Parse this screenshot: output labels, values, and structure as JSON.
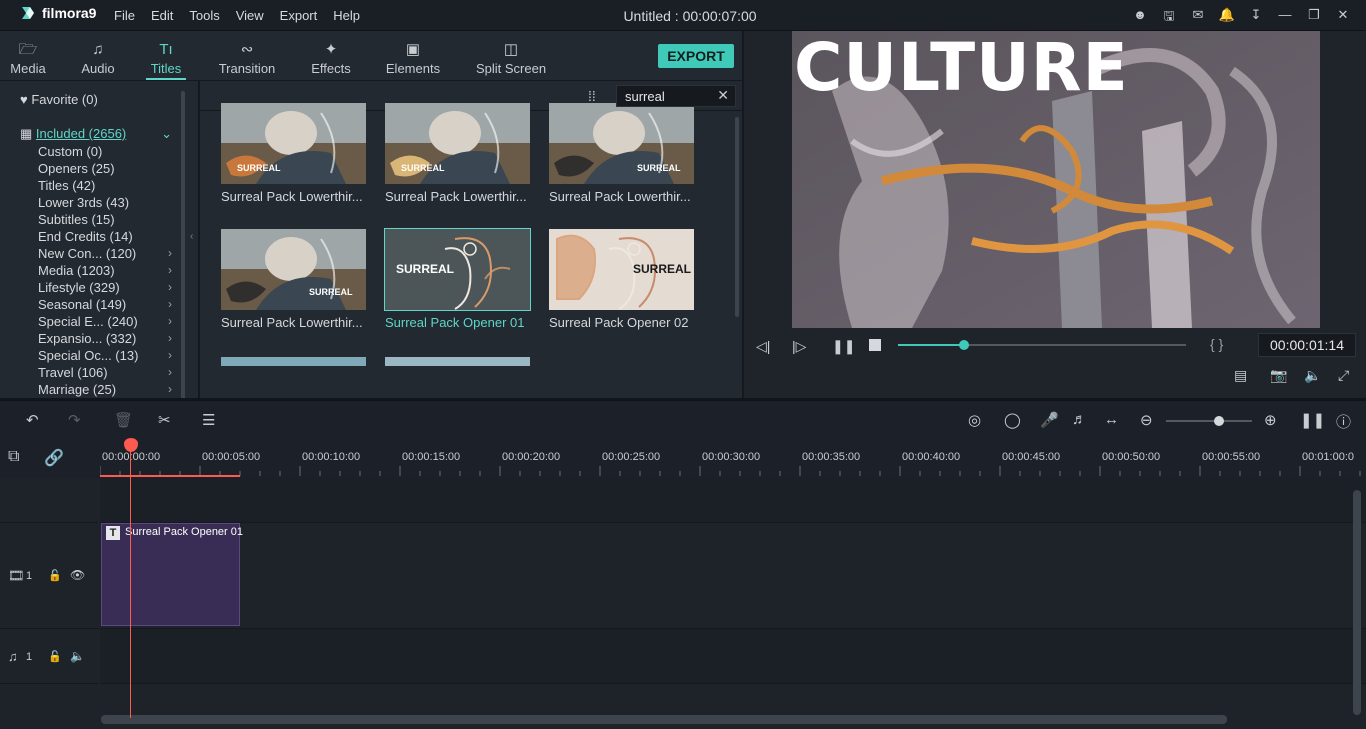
{
  "app": {
    "name": "filmora9",
    "title": "Untitled : 00:00:07:00",
    "menu": [
      "File",
      "Edit",
      "Tools",
      "View",
      "Export",
      "Help"
    ]
  },
  "tabs": [
    {
      "label": "Media",
      "icon": "media-icon"
    },
    {
      "label": "Audio",
      "icon": "music-note-icon"
    },
    {
      "label": "Titles",
      "icon": "titles-icon",
      "active": true
    },
    {
      "label": "Transition",
      "icon": "transition-icon"
    },
    {
      "label": "Effects",
      "icon": "effects-icon"
    },
    {
      "label": "Elements",
      "icon": "elements-icon"
    },
    {
      "label": "Split Screen",
      "icon": "split-screen-icon"
    }
  ],
  "export_label": "EXPORT",
  "favorite": "Favorite (0)",
  "included": "Included (2656)",
  "categories": [
    {
      "label": "Custom (0)",
      "has_children": false
    },
    {
      "label": "Openers (25)",
      "has_children": false
    },
    {
      "label": "Titles (42)",
      "has_children": false
    },
    {
      "label": "Lower 3rds (43)",
      "has_children": false
    },
    {
      "label": "Subtitles (15)",
      "has_children": false
    },
    {
      "label": "End Credits (14)",
      "has_children": false
    },
    {
      "label": "New Con... (120)",
      "has_children": true
    },
    {
      "label": "Media (1203)",
      "has_children": true
    },
    {
      "label": "Lifestyle (329)",
      "has_children": true
    },
    {
      "label": "Seasonal (149)",
      "has_children": true
    },
    {
      "label": "Special E... (240)",
      "has_children": true
    },
    {
      "label": "Expansio... (332)",
      "has_children": true
    },
    {
      "label": "Special Oc... (13)",
      "has_children": true
    },
    {
      "label": "Travel (106)",
      "has_children": true
    },
    {
      "label": "Marriage (25)",
      "has_children": true
    }
  ],
  "search": {
    "value": "surreal"
  },
  "thumbnails": [
    {
      "label": "Surreal Pack Lowerthir...",
      "overlay": "SURREAL",
      "selected": false
    },
    {
      "label": "Surreal Pack Lowerthir...",
      "overlay": "SURREAL",
      "selected": false
    },
    {
      "label": "Surreal Pack Lowerthir...",
      "overlay": "SURREAL",
      "selected": false
    },
    {
      "label": "Surreal Pack Lowerthir...",
      "overlay": "SURREAL",
      "selected": false
    },
    {
      "label": "Surreal Pack Opener 01",
      "overlay": "SURREAL",
      "selected": true
    },
    {
      "label": "Surreal Pack Opener 02",
      "overlay": "SURREAL",
      "selected": false
    }
  ],
  "preview": {
    "overlay_text": "CULTURE",
    "timecode": "00:00:01:14",
    "progress": 0.23,
    "brackets": "{   }"
  },
  "ruler": [
    "00:00:00:00",
    "00:00:05:00",
    "00:00:10:00",
    "00:00:15:00",
    "00:00:20:00",
    "00:00:25:00",
    "00:00:30:00",
    "00:00:35:00",
    "00:00:40:00",
    "00:00:45:00",
    "00:00:50:00",
    "00:00:55:00",
    "00:01:00:0"
  ],
  "tracks": {
    "video": {
      "number": "1"
    },
    "audio": {
      "number": "1"
    }
  },
  "clip": {
    "label": "Surreal Pack Opener 01"
  },
  "colors": {
    "accent": "#3fc9b8",
    "playhead": "#ff5a4f",
    "clip": "#3a2d55"
  }
}
